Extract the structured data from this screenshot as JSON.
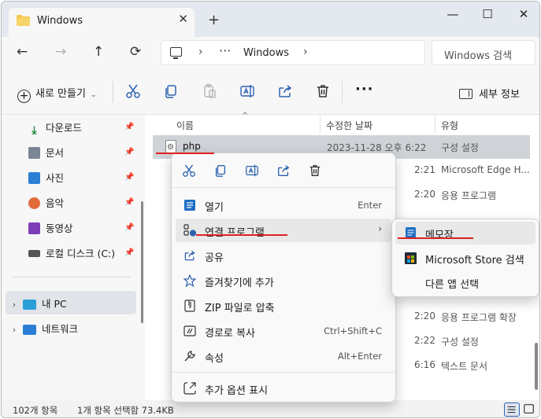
{
  "window": {
    "tab_title": "Windows",
    "tab_close": "✕",
    "new_tab": "+",
    "controls": {
      "minimize": "—",
      "maximize": "☐",
      "close": "✕"
    }
  },
  "nav": {
    "back": "←",
    "forward": "→",
    "up": "↑",
    "refresh": "⟳",
    "address_more": "···",
    "address_chevron": "›",
    "address_text": "Windows",
    "search_placeholder": "Windows 검색"
  },
  "toolbar": {
    "new_label": "새로 만들기",
    "new_caret": "⌄",
    "more": "···",
    "details_label": "세부 정보",
    "icons": [
      "cut-icon",
      "copy-icon",
      "paste-icon",
      "rename-icon",
      "share-icon",
      "delete-icon"
    ]
  },
  "sidebar": {
    "quick": [
      {
        "label": "다운로드",
        "icon": "download-icon",
        "color": "#1f8a3b"
      },
      {
        "label": "문서",
        "icon": "document-icon",
        "color": "#7a8694"
      },
      {
        "label": "사진",
        "icon": "pictures-icon",
        "color": "#2a7fd4"
      },
      {
        "label": "음악",
        "icon": "music-icon",
        "color": "#e26b3c"
      },
      {
        "label": "동영상",
        "icon": "video-icon",
        "color": "#7d3fb8"
      },
      {
        "label": "로컬 디스크 (C:)",
        "icon": "drive-icon",
        "color": "#555555"
      }
    ],
    "pin_glyph": "📌",
    "tree": [
      {
        "label": "내 PC",
        "icon": "pc-icon",
        "chevron": "›"
      },
      {
        "label": "네트워크",
        "icon": "network-icon",
        "chevron": "›"
      }
    ]
  },
  "list": {
    "headers": {
      "name": "이름",
      "date": "수정한 날짜",
      "type": "유형"
    },
    "sort_arrow": "^",
    "rows": [
      {
        "name": "php",
        "date": "2023-11-28 오후 6:22",
        "type": "구성 설정",
        "selected": true
      },
      {
        "name": "",
        "date": "2:21",
        "type": "Microsoft Edge H..."
      },
      {
        "name": "",
        "date": "2:20",
        "type": "응용 프로그램"
      },
      {
        "name": "",
        "date": "2:20",
        "type": "응용 프로그램 확장"
      },
      {
        "name": "",
        "date": "2:22",
        "type": "구성 설정"
      },
      {
        "name": "",
        "date": "6:16",
        "type": "텍스트 문서"
      }
    ]
  },
  "context_menu": {
    "quick_icons": [
      "cut-icon",
      "copy-icon",
      "rename-icon",
      "share-icon",
      "delete-icon"
    ],
    "items": [
      {
        "label": "열기",
        "shortcut": "Enter",
        "icon": "open-icon"
      },
      {
        "label": "연결 프로그램",
        "shortcut": "",
        "icon": "open-with-icon",
        "has_submenu": true,
        "arrow": "›"
      },
      {
        "label": "공유",
        "shortcut": "",
        "icon": "share-icon"
      },
      {
        "label": "즐겨찾기에 추가",
        "shortcut": "",
        "icon": "star-icon"
      },
      {
        "label": "ZIP 파일로 압축",
        "shortcut": "",
        "icon": "zip-icon"
      },
      {
        "label": "경로로 복사",
        "shortcut": "Ctrl+Shift+C",
        "icon": "copy-path-icon"
      },
      {
        "label": "속성",
        "shortcut": "Alt+Enter",
        "icon": "properties-icon"
      },
      {
        "label": "추가 옵션 표시",
        "shortcut": "",
        "icon": "more-options-icon"
      }
    ]
  },
  "submenu": {
    "items": [
      {
        "label": "메모장",
        "icon": "notepad-icon"
      },
      {
        "label": "Microsoft Store 검색",
        "icon": "store-icon"
      },
      {
        "label": "다른 앱 선택",
        "icon": ""
      }
    ]
  },
  "status": {
    "item_count": "102개 항목",
    "selection": "1개 항목 선택함 73.4KB"
  },
  "colors": {
    "accent": "#2d62b0",
    "annotation": "#e02020",
    "selection_row": "#cfd3d8",
    "folder": "#f2c94c"
  }
}
